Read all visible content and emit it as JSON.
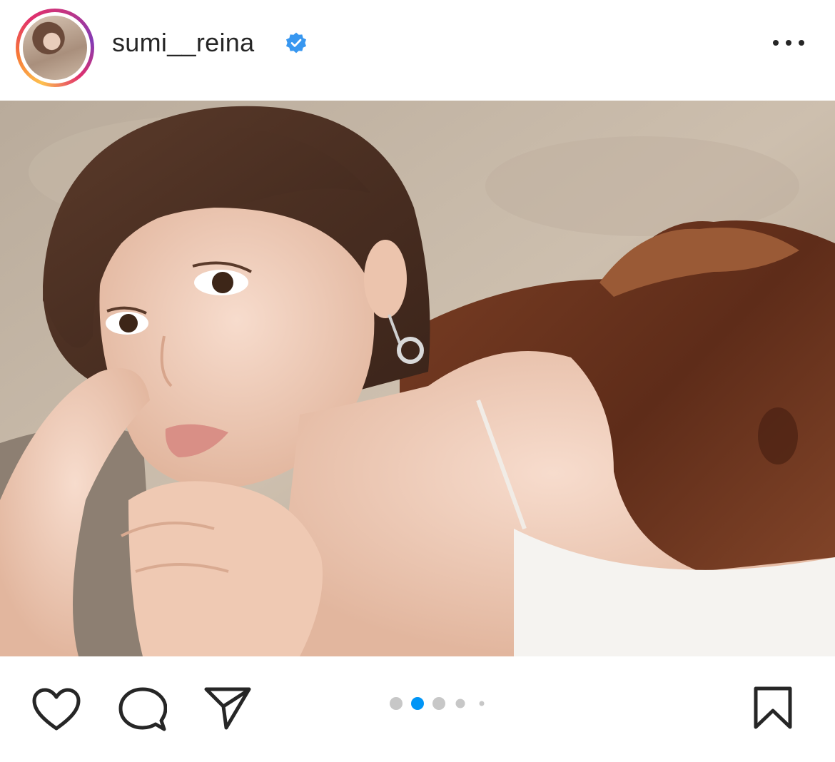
{
  "post": {
    "username": "sumi__reina",
    "verified": true,
    "carousel": {
      "total": 5,
      "active_index": 1
    }
  },
  "icons": {
    "verified": "verified-badge-icon",
    "more": "more-options-icon",
    "like": "heart-icon",
    "comment": "comment-icon",
    "share": "share-icon",
    "save": "bookmark-icon"
  },
  "colors": {
    "text": "#262626",
    "verified_blue": "#3897f0",
    "active_dot": "#0095f6",
    "inactive_dot": "#c7c7c7"
  }
}
